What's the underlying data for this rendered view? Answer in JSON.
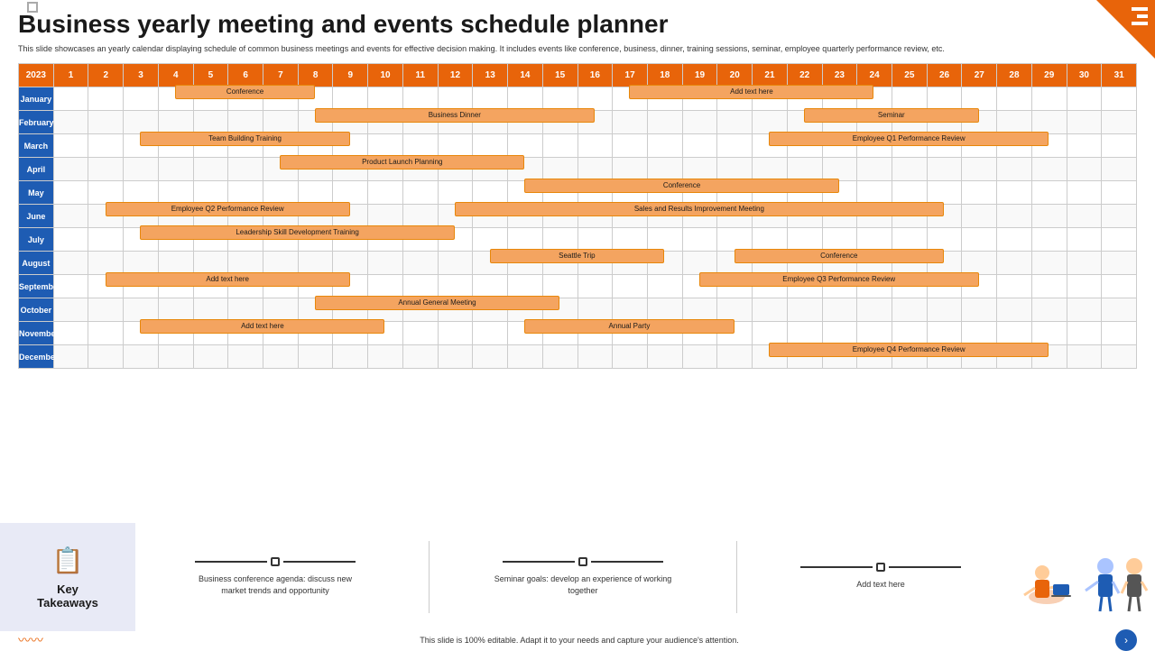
{
  "title": "Business yearly meeting and events schedule planner",
  "subtitle": "This slide showcases an yearly calendar displaying schedule of common business meetings and events for effective decision making. It includes events like conference, business, dinner, training sessions, seminar, employee quarterly performance review, etc.",
  "year": "2023",
  "days": [
    "1",
    "2",
    "3",
    "4",
    "5",
    "6",
    "7",
    "8",
    "9",
    "10",
    "11",
    "12",
    "13",
    "14",
    "15",
    "16",
    "17",
    "18",
    "19",
    "20",
    "21",
    "22",
    "23",
    "24",
    "25",
    "26",
    "27",
    "28",
    "29",
    "30",
    "31"
  ],
  "months": [
    "January",
    "February",
    "March",
    "April",
    "May",
    "June",
    "July",
    "August",
    "September",
    "October",
    "November",
    "December"
  ],
  "events": {
    "January": [
      {
        "label": "Conference",
        "start": 5,
        "end": 8
      },
      {
        "label": "Add text here",
        "start": 18,
        "end": 24
      }
    ],
    "February": [
      {
        "label": "Business Dinner",
        "start": 9,
        "end": 16
      },
      {
        "label": "Seminar",
        "start": 23,
        "end": 27
      }
    ],
    "March": [
      {
        "label": "Team Building Training",
        "start": 4,
        "end": 9
      },
      {
        "label": "Employee Q1 Performance Review",
        "start": 22,
        "end": 29
      }
    ],
    "April": [
      {
        "label": "Product Launch Planning",
        "start": 8,
        "end": 14
      }
    ],
    "May": [
      {
        "label": "Conference",
        "start": 15,
        "end": 23
      }
    ],
    "June": [
      {
        "label": "Employee Q2 Performance Review",
        "start": 3,
        "end": 9
      },
      {
        "label": "Sales and Results Improvement Meeting",
        "start": 13,
        "end": 26
      }
    ],
    "July": [
      {
        "label": "Leadership Skill Development Training",
        "start": 4,
        "end": 12
      }
    ],
    "August": [
      {
        "label": "Seattle Trip",
        "start": 14,
        "end": 18
      },
      {
        "label": "Conference",
        "start": 21,
        "end": 26
      }
    ],
    "September": [
      {
        "label": "Add text here",
        "start": 3,
        "end": 9
      },
      {
        "label": "Employee Q3 Performance Review",
        "start": 20,
        "end": 27
      }
    ],
    "October": [
      {
        "label": "Annual General Meeting",
        "start": 9,
        "end": 15
      }
    ],
    "November": [
      {
        "label": "Add text here",
        "start": 4,
        "end": 10
      },
      {
        "label": "Annual Party",
        "start": 15,
        "end": 20
      }
    ],
    "December": [
      {
        "label": "Employee Q4 Performance Review",
        "start": 22,
        "end": 29
      }
    ]
  },
  "takeaways": {
    "label": "Key\nTakeaways",
    "items": [
      "Business conference agenda: discuss new market trends and opportunity",
      "Seminar goals: develop an experience of working together",
      "Add text here"
    ]
  },
  "footer_text": "This slide is 100% editable. Adapt it to your needs and capture your audience's attention."
}
